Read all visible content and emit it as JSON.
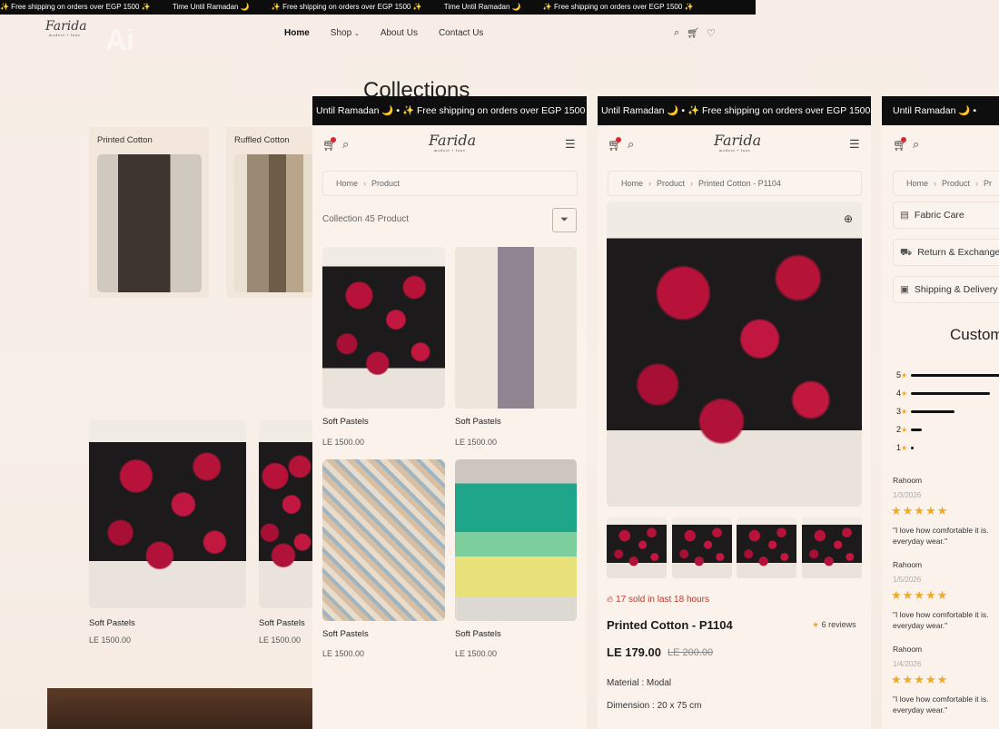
{
  "desktop": {
    "announcement": [
      "✨ Free shipping on orders over EGP 1500 ✨",
      "Time Until Ramadan 🌙",
      "✨ Free shipping on orders over EGP 1500 ✨",
      "Time Until Ramadan 🌙",
      "✨ Free shipping on orders over EGP 1500 ✨"
    ],
    "logo": "Farida",
    "logo_tag": "modest • luxe",
    "ai_mark": "Ai",
    "nav": [
      "Home",
      "Shop",
      "About Us",
      "Contact Us"
    ],
    "page_title": "Collections",
    "collections": [
      "Printed Cotton",
      "Ruffled Cotton"
    ],
    "products": [
      {
        "name": "Soft Pastels",
        "price": "LE 1500.00"
      },
      {
        "name": "Soft Pastels",
        "price": "LE 1500.00"
      }
    ]
  },
  "listing": {
    "announcement": "Until Ramadan 🌙   •   ✨ Free shipping on orders over EGP 1500",
    "logo": "Farida",
    "logo_tag": "modest • luxe",
    "breadcrumb": [
      "Home",
      "Product"
    ],
    "collection_label": "Collection 45 Product",
    "products": [
      {
        "name": "Soft Pastels",
        "price": "LE 1500.00"
      },
      {
        "name": "Soft Pastels",
        "price": "LE 1500.00"
      },
      {
        "name": "Soft Pastels",
        "price": "LE 1500.00"
      },
      {
        "name": "Soft Pastels",
        "price": "LE 1500.00"
      }
    ]
  },
  "detail": {
    "announcement": "Until Ramadan 🌙   •   ✨ Free shipping on orders over EGP 1500",
    "logo": "Farida",
    "logo_tag": "modest • luxe",
    "breadcrumb": [
      "Home",
      "Product",
      "Printed Cotton - P1104"
    ],
    "sold_text": "17 sold in last 18 hours",
    "title": "Printed Cotton - P1104",
    "reviews": "6 reviews",
    "price": "LE 179.00",
    "old_price": "LE 200.00",
    "material": "Material : Modal",
    "dimension": "Dimension : 20 x 75 cm"
  },
  "reviews_panel": {
    "announcement": "Until Ramadan 🌙   •",
    "breadcrumb": [
      "Home",
      "Product",
      "Pr"
    ],
    "accordions": [
      "Fabric Care",
      "Return & Exchange",
      "Shipping & Delivery"
    ],
    "heading": "Custom",
    "rating_rows": [
      {
        "label": "5 ★",
        "fill": 1.0
      },
      {
        "label": "4 ★",
        "fill": 0.72
      },
      {
        "label": "3 ★",
        "fill": 0.4
      },
      {
        "label": "2 ★",
        "fill": 0.1
      },
      {
        "label": "1 ★",
        "fill": 0.02
      }
    ],
    "reviews": [
      {
        "name": "Rahoom",
        "date": "1/3/2026",
        "stars": "★★★★★",
        "text": "\"I love how comfortable it is. everyday wear.\""
      },
      {
        "name": "Rahoom",
        "date": "1/5/2026",
        "stars": "★★★★★",
        "text": "\"I love how comfortable it is. everyday wear.\""
      },
      {
        "name": "Rahoom",
        "date": "1/4/2026",
        "stars": "★★★★★",
        "text": "\"I love how comfortable it is. everyday wear.\""
      }
    ]
  },
  "colors": {
    "accent": "#f0a928",
    "badge": "#d8262e",
    "bar": "#0e0e0e",
    "background": "#f9efe8"
  }
}
